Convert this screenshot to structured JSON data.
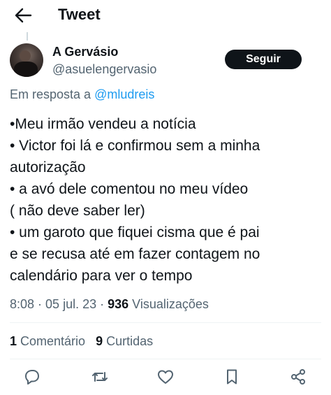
{
  "header": {
    "title": "Tweet"
  },
  "author": {
    "name": "A Gervásio",
    "handle": "@asuelengervasio",
    "follow_label": "Seguir"
  },
  "reply": {
    "prefix": "Em resposta a ",
    "mention": "@mludreis"
  },
  "tweet": {
    "lines": [
      "•Meu irmão vendeu a notícia",
      "• Victor foi lá e confirmou sem a minha",
      "autorização",
      "• a avó dele comentou no meu vídeo",
      "( não deve saber ler)",
      "• um garoto que fiquei cisma que é pai",
      "e se recusa até em fazer contagem no",
      "calendário para ver o tempo"
    ]
  },
  "meta": {
    "time": "8:08",
    "sep1": " · ",
    "date": "05 jul. 23",
    "sep2": " · ",
    "views_count": "936",
    "views_label": " Visualizações"
  },
  "stats": {
    "comments_count": "1",
    "comments_label": " Comentário",
    "retweets_count": "9",
    "retweets_label": " Curtidas"
  },
  "colors": {
    "accent": "#1d9bf0",
    "text": "#0f1419",
    "muted": "#536471",
    "divider": "#eff3f4"
  },
  "icons": [
    "back-arrow-icon",
    "reply-icon",
    "retweet-icon",
    "like-icon",
    "bookmark-icon",
    "share-icon"
  ]
}
